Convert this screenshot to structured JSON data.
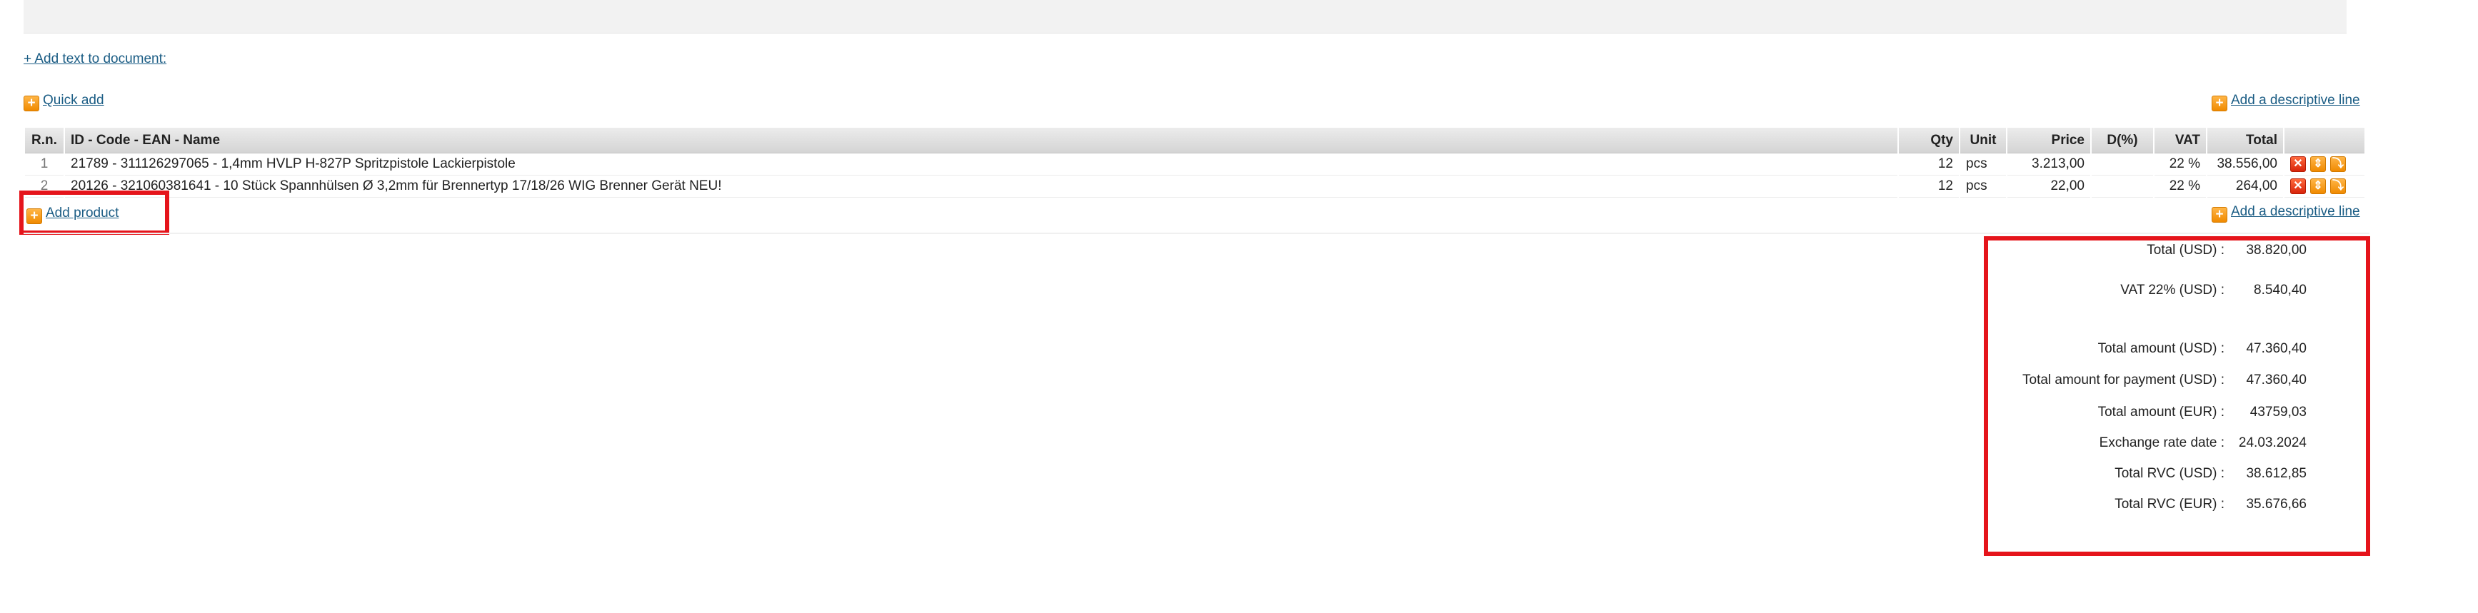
{
  "header": {
    "add_text_link": "+ Add text to document:",
    "quick_add": "Quick add",
    "add_descriptive_line": "Add a descriptive line"
  },
  "table": {
    "columns": [
      "R.n.",
      "ID - Code - EAN - Name",
      "Qty",
      "Unit",
      "Price",
      "D(%)",
      "VAT",
      "Total"
    ],
    "rows": [
      {
        "rn": "1",
        "name": "21789 - 311126297065 - 1,4mm HVLP H-827P Spritzpistole Lackierpistole",
        "qty": "12",
        "unit": "pcs",
        "price": "3.213,00",
        "discount": "",
        "vat": "22 %",
        "total": "38.556,00"
      },
      {
        "rn": "2",
        "name": "20126 - 321060381641 - 10 Stück Spannhülsen Ø 3,2mm für Brennertyp 17/18/26 WIG Brenner Gerät NEU!",
        "qty": "12",
        "unit": "pcs",
        "price": "22,00",
        "discount": "",
        "vat": "22 %",
        "total": "264,00"
      }
    ]
  },
  "footer": {
    "add_product": "Add product",
    "add_descriptive_line": "Add a descriptive line"
  },
  "summary": [
    {
      "label": "Total (USD) :",
      "value": "38.820,00"
    },
    {
      "label": "VAT 22% (USD) :",
      "value": "8.540,40"
    },
    {
      "label": "Total amount (USD) :",
      "value": "47.360,40"
    },
    {
      "label": "Total amount for payment (USD) :",
      "value": "47.360,40"
    },
    {
      "label": "Total amount (EUR) :",
      "value": "43759,03"
    },
    {
      "label": "Exchange rate date :",
      "value": "24.03.2024"
    },
    {
      "label": "Total RVC (USD) :",
      "value": "38.612,85"
    },
    {
      "label": "Total RVC (EUR) :",
      "value": "35.676,66"
    }
  ],
  "colors": {
    "link": "#1a5c84",
    "highlight": "#e5141b",
    "accent": "#f08a00"
  },
  "icons": [
    "plus-icon",
    "delete-icon",
    "move-up-icon",
    "move-down-icon"
  ]
}
